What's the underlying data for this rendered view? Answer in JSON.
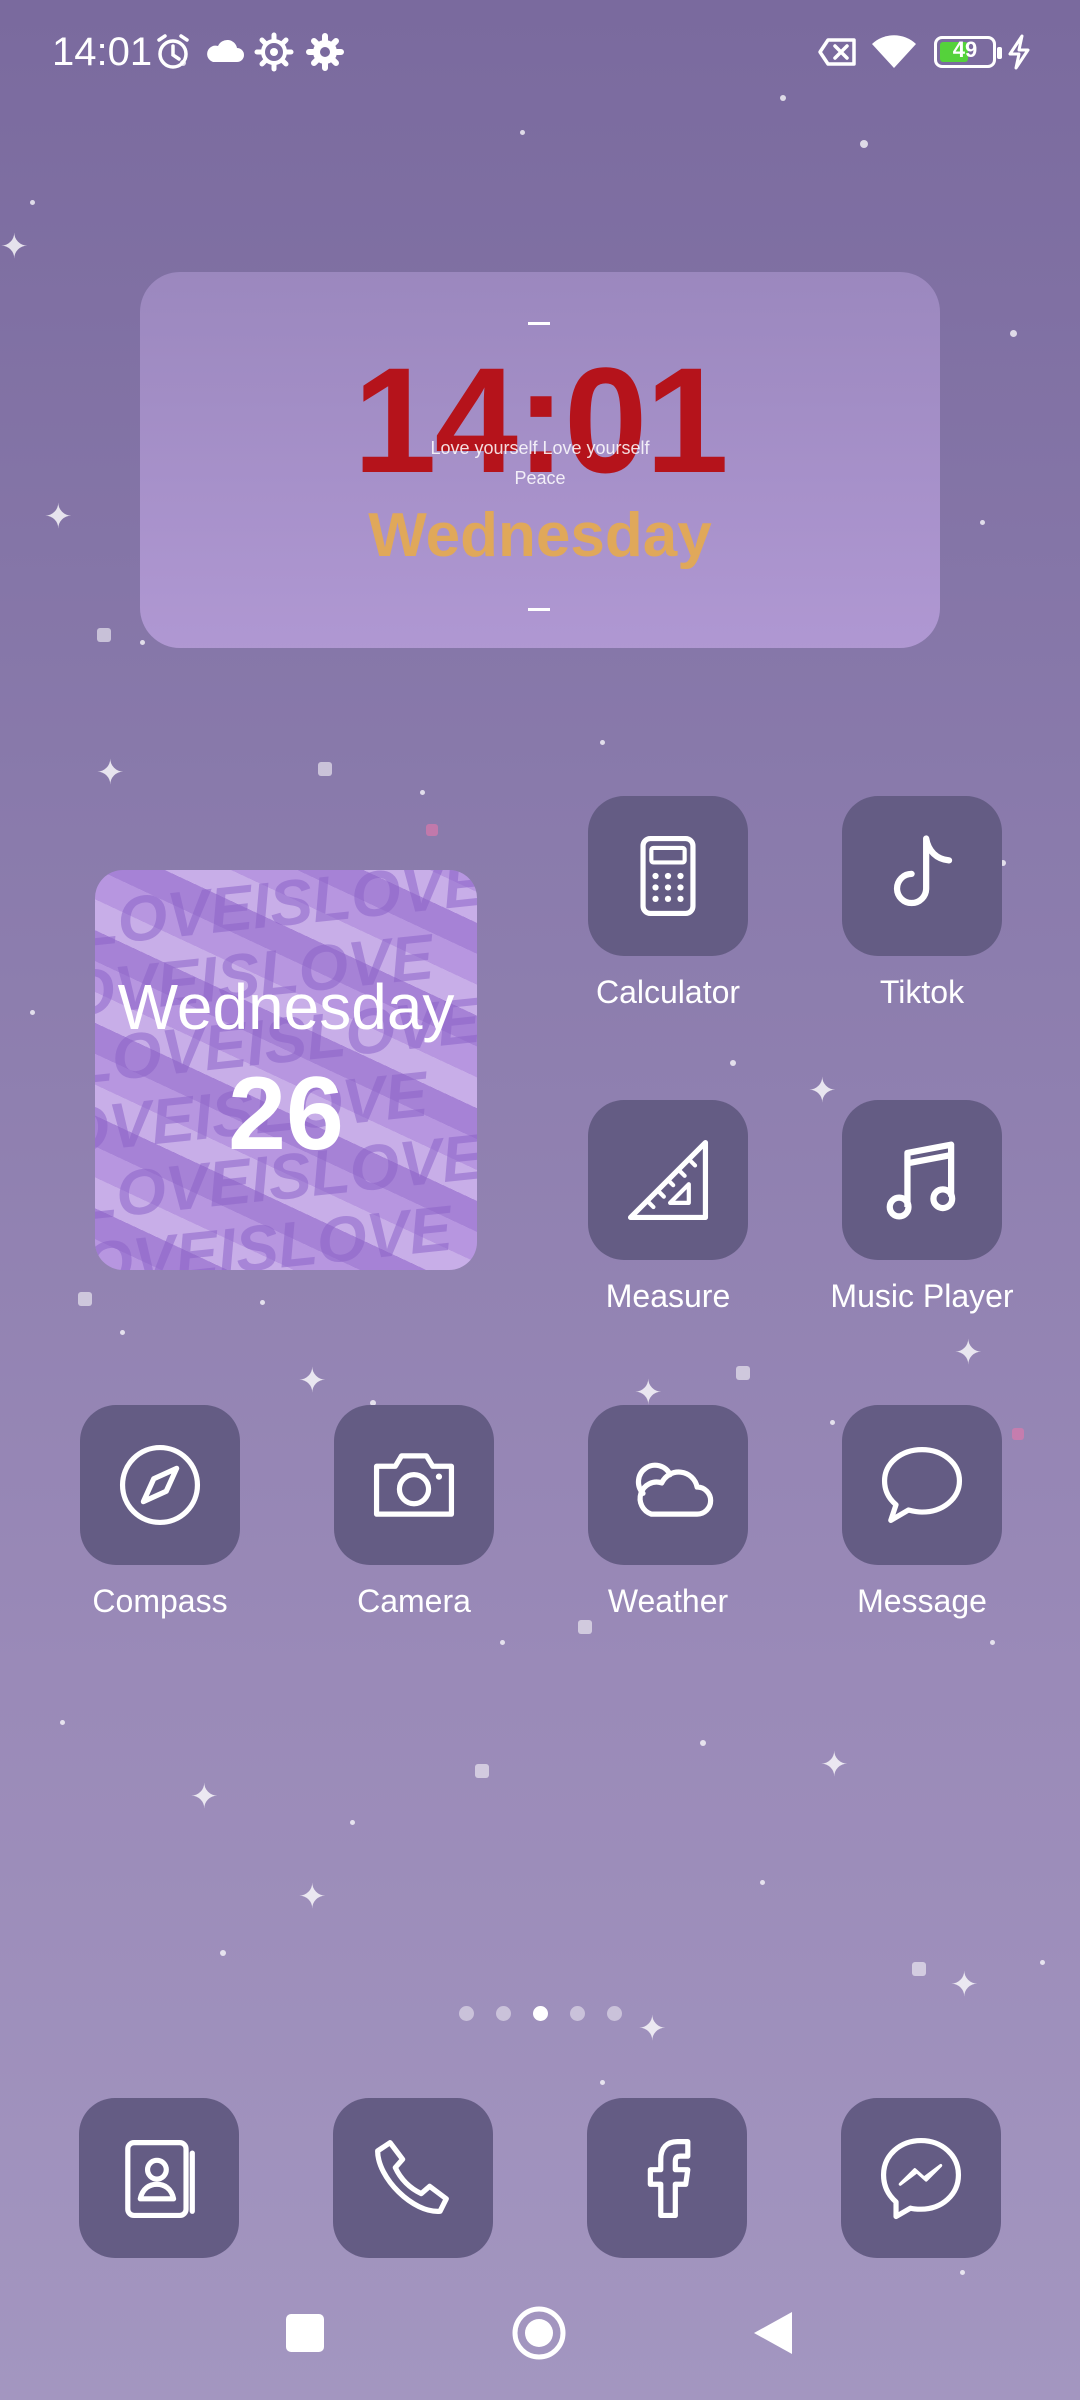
{
  "status_bar": {
    "time": "14:01",
    "battery_level": "49",
    "icons": [
      "alarm-icon",
      "cloud-icon",
      "gear-icon",
      "settings-icon",
      "sim-off-icon",
      "wifi-icon",
      "battery-icon",
      "charging-icon"
    ]
  },
  "clock_widget": {
    "time": "14:01",
    "caption_line1": "Love yourself Love yourself",
    "caption_line2": "Peace",
    "day": "Wednesday"
  },
  "date_widget": {
    "day": "Wednesday",
    "date": "26",
    "pattern_text": "LOVEISLOVE"
  },
  "apps": [
    {
      "label": "Calculator",
      "icon": "calculator-icon"
    },
    {
      "label": "Tiktok",
      "icon": "tiktok-icon"
    },
    {
      "label": "Measure",
      "icon": "ruler-icon"
    },
    {
      "label": "Music Player",
      "icon": "music-note-icon"
    },
    {
      "label": "Compass",
      "icon": "compass-icon"
    },
    {
      "label": "Camera",
      "icon": "camera-icon"
    },
    {
      "label": "Weather",
      "icon": "cloud-icon"
    },
    {
      "label": "Message",
      "icon": "chat-bubble-icon"
    }
  ],
  "dock": [
    {
      "icon": "contacts-icon"
    },
    {
      "icon": "phone-icon"
    },
    {
      "icon": "facebook-icon"
    },
    {
      "icon": "messenger-icon"
    }
  ],
  "pager": {
    "count": 5,
    "active": 3
  },
  "colors": {
    "tile": "#645c84",
    "clock_time": "#b5131b",
    "clock_day": "#e0a85a",
    "battery_fill": "#55d23b"
  }
}
